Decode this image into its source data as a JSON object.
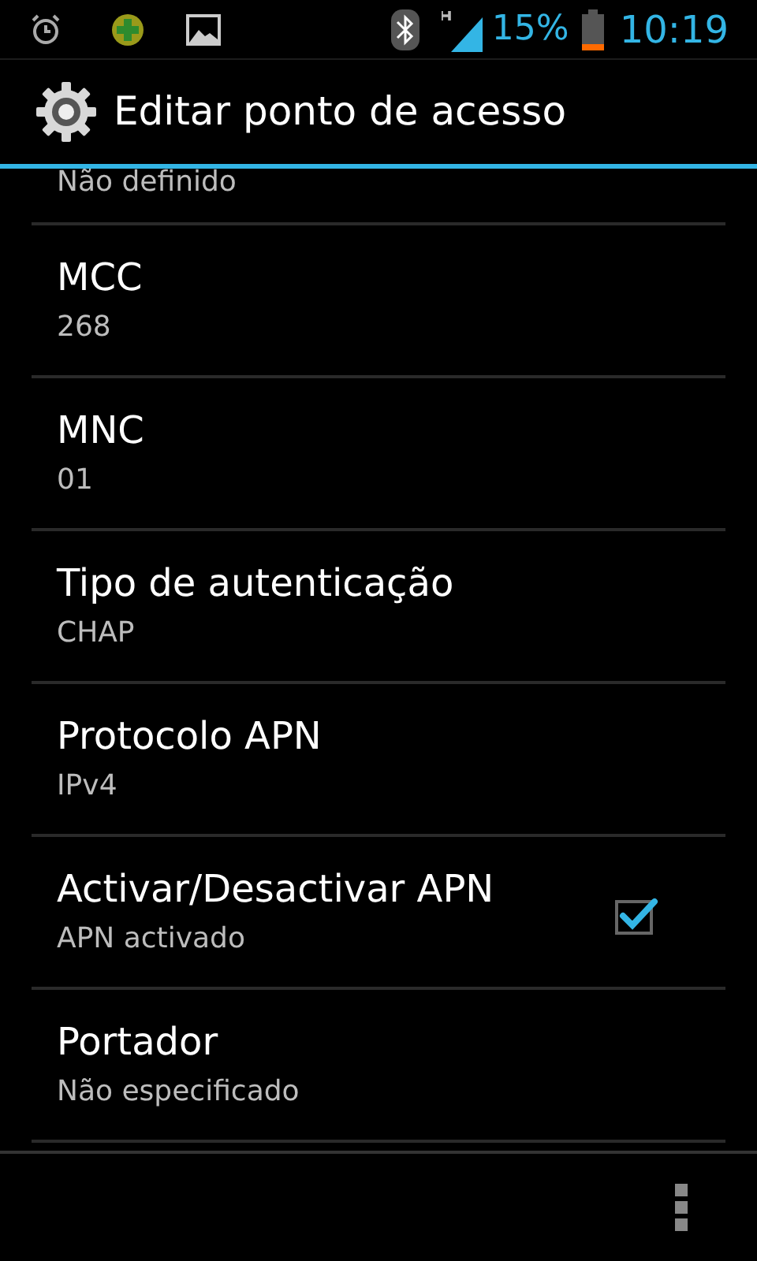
{
  "status_bar": {
    "battery": "15%",
    "time": "10:19"
  },
  "action_bar": {
    "title": "Editar ponto de acesso"
  },
  "partial_item": {
    "summary": "Não definido"
  },
  "settings": [
    {
      "kind": "text",
      "title": "MCC",
      "summary": "268"
    },
    {
      "kind": "text",
      "title": "MNC",
      "summary": "01"
    },
    {
      "kind": "text",
      "title": "Tipo de autenticação",
      "summary": "CHAP"
    },
    {
      "kind": "text",
      "title": "Protocolo APN",
      "summary": "IPv4"
    },
    {
      "kind": "checkbox",
      "title": "Activar/Desactivar APN",
      "summary": "APN activado",
      "checked": true
    },
    {
      "kind": "text",
      "title": "Portador",
      "summary": "Não especificado"
    }
  ]
}
